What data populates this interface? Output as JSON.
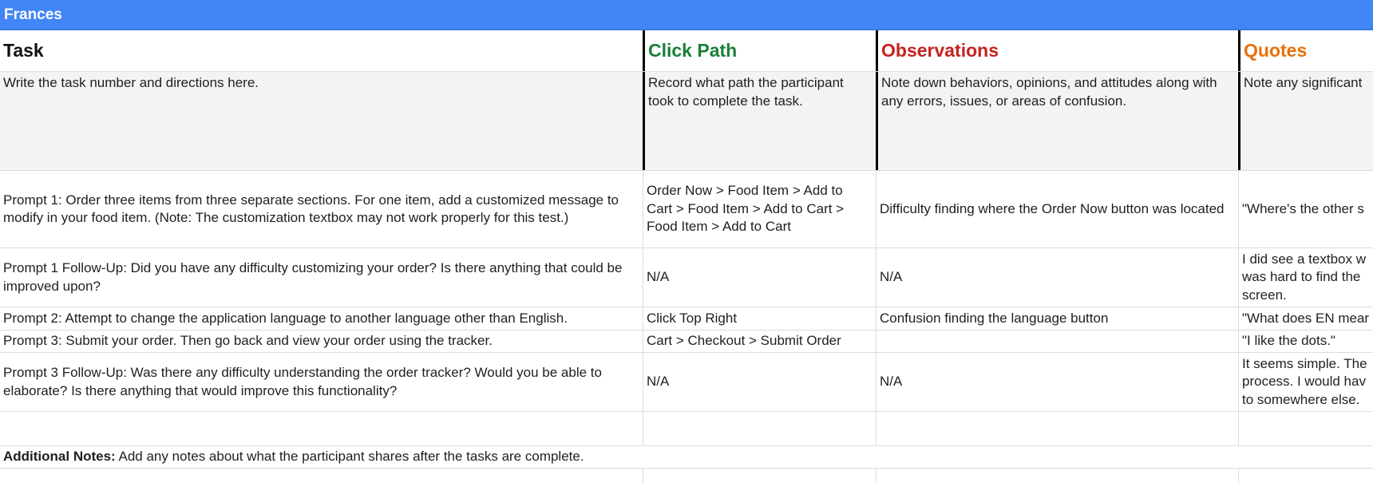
{
  "sheet": {
    "banner_title": "Frances",
    "headers": {
      "task": "Task",
      "click_path": "Click Path",
      "observations": "Observations",
      "quotes": "Quotes"
    },
    "header_colors": {
      "task": "#111111",
      "click_path": "#188038",
      "observations": "#c5221f",
      "quotes": "#e8710a"
    },
    "banner_color": "#4285f4",
    "descriptions": {
      "task": "Write the task number and directions here.",
      "click_path": "Record what path the participant took to complete the task.",
      "observations": "Note down behaviors, opinions, and attitudes along with any errors, issues, or areas of confusion.",
      "quotes": "Note any significant"
    },
    "rows": [
      {
        "task": "Prompt 1: Order three items from three separate sections. For one item, add a customized message to modify in your food item. (Note: The customization textbox may not work properly for this test.)",
        "click_path": "Order Now > Food Item > Add to Cart > Food Item > Add to Cart > Food Item > Add to Cart",
        "observations": "Difficulty finding where the Order Now button was located",
        "quotes": "\"Where's the other s"
      },
      {
        "task": "Prompt 1 Follow-Up: Did you have any difficulty customizing your order? Is there anything that could be improved upon?",
        "click_path": "N/A",
        "observations": "N/A",
        "quotes_lines": [
          "I did see a textbox w",
          "was hard to find the",
          "screen."
        ]
      },
      {
        "task": "Prompt 2: Attempt to change the application language to another language other than English.",
        "click_path": "Click Top Right",
        "observations": "Confusion finding the language button",
        "quotes": "\"What does EN mear"
      },
      {
        "task": "Prompt 3: Submit your order. Then go back and view your order using the tracker.",
        "click_path": "Cart > Checkout > Submit Order",
        "observations": "",
        "quotes": "\"I like the dots.\""
      },
      {
        "task": "Prompt 3 Follow-Up: Was there any difficulty understanding the order tracker? Would you be able to elaborate? Is there anything that would improve this functionality?",
        "click_path": "N/A",
        "observations": "N/A",
        "quotes_lines": [
          "It seems simple. The",
          "process. I would hav",
          "to somewhere else."
        ]
      }
    ],
    "additional_notes": {
      "label": "Additional Notes:",
      "text": " Add any notes about what the participant shares after the tasks are complete."
    }
  }
}
